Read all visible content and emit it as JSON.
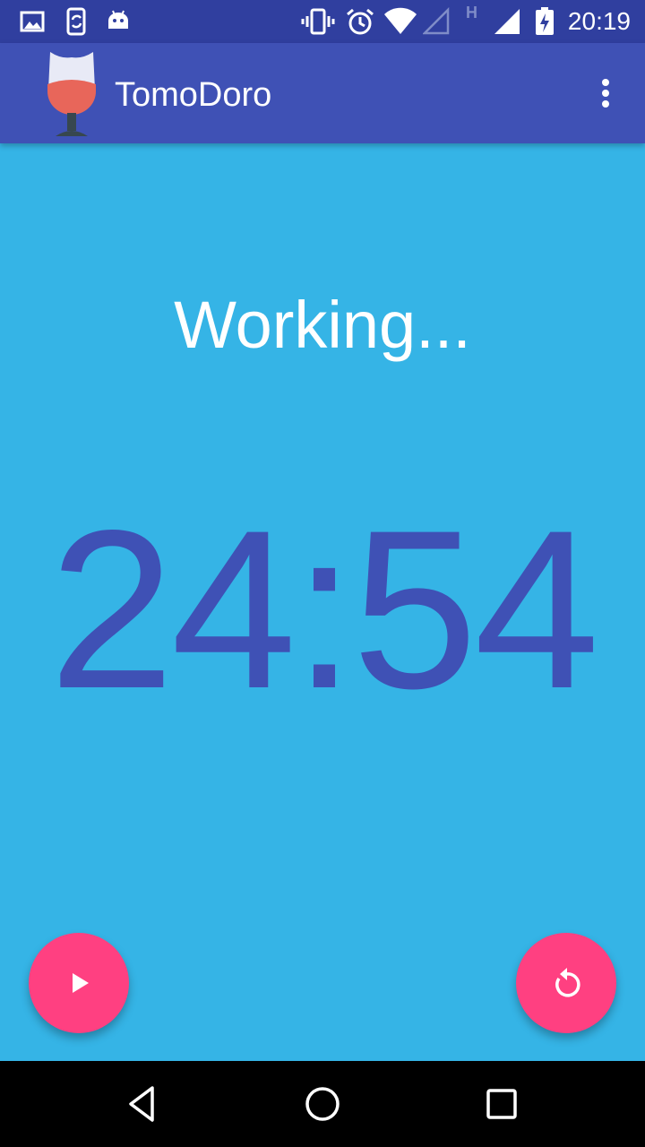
{
  "status_bar": {
    "time": "20:19",
    "icons": [
      "gallery-icon",
      "phone-sync-icon",
      "android-icon",
      "vibrate-icon",
      "alarm-icon",
      "wifi-icon",
      "signal-empty-icon",
      "network-h-icon",
      "signal-icon",
      "battery-charging-icon"
    ],
    "network_type": "H"
  },
  "app_bar": {
    "title": "TomoDoro",
    "logo_icon": "wine-glass-icon",
    "menu_icon": "more-vert-icon"
  },
  "main": {
    "status_text": "Working...",
    "timer": "24:54"
  },
  "fabs": {
    "play_icon": "play-icon",
    "reset_icon": "replay-icon"
  },
  "nav_bar": {
    "icons": [
      "back-icon",
      "home-icon",
      "recents-icon"
    ]
  },
  "colors": {
    "status_bar": "#303f9f",
    "app_bar": "#3f51b5",
    "background": "#35b4e6",
    "timer_text": "#3f51b5",
    "fab": "#ff4081",
    "nav_bar": "#000000"
  }
}
